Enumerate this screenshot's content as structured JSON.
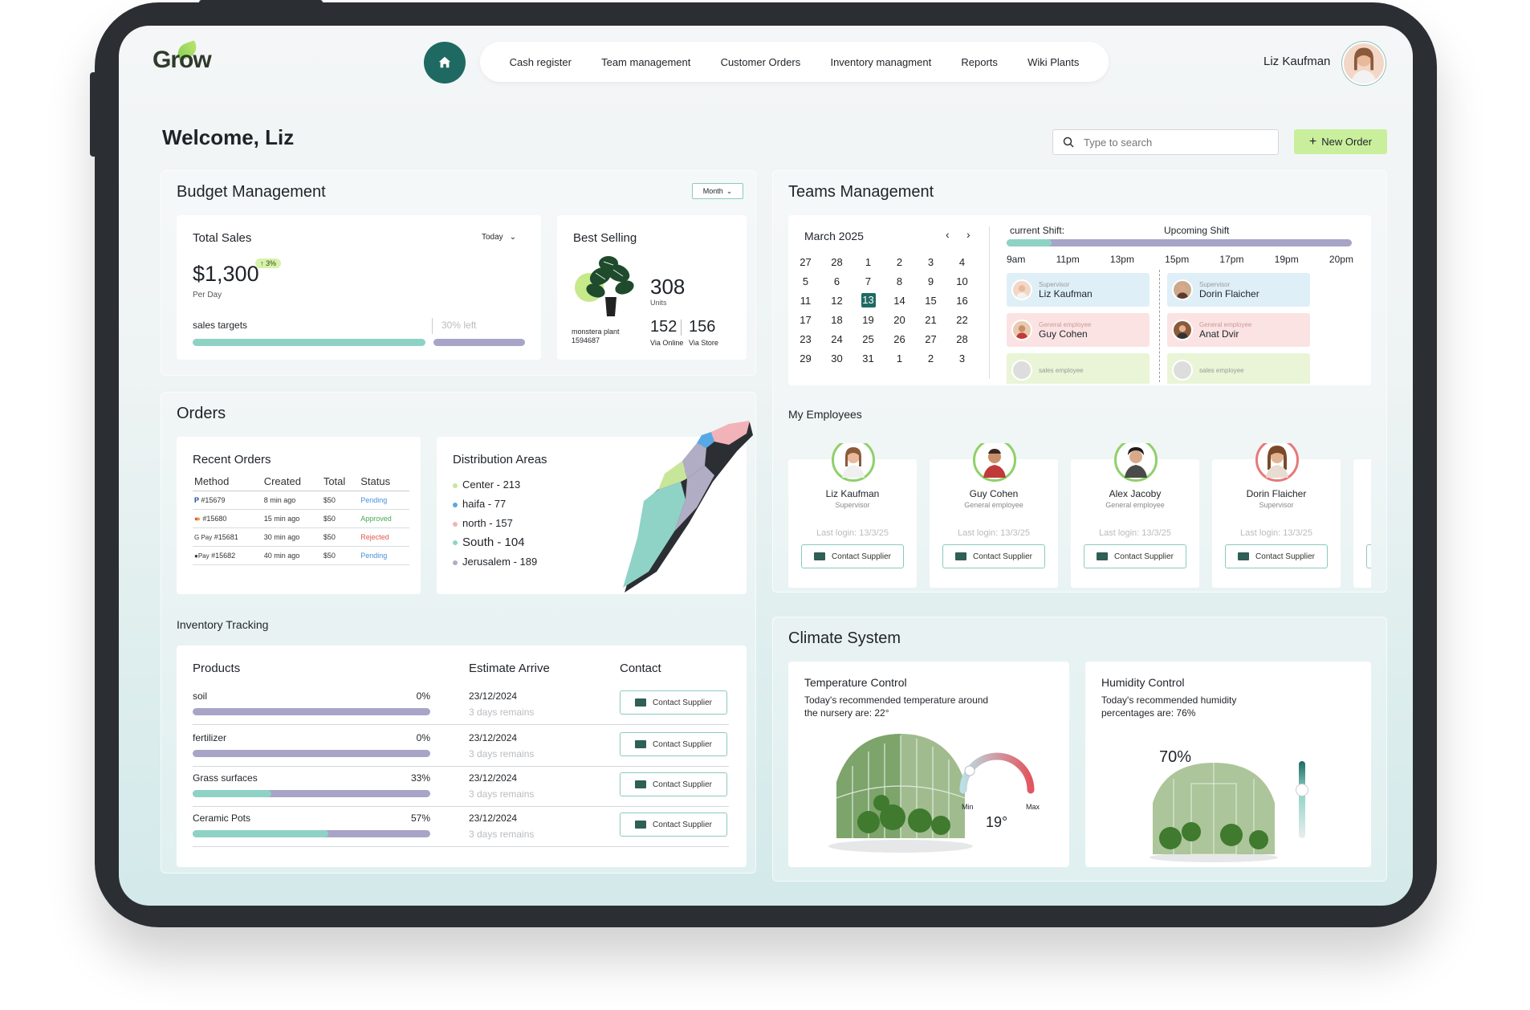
{
  "app": {
    "logo": "Grow",
    "user_name": "Liz Kaufman"
  },
  "nav": {
    "items": [
      "Cash register",
      "Team management",
      "Customer Orders",
      "Inventory managment",
      "Reports",
      "Wiki Plants"
    ]
  },
  "welcome": "Welcome, Liz",
  "search": {
    "placeholder": "Type to search"
  },
  "new_order": "New Order",
  "budget": {
    "title": "Budget Management",
    "period": "Month",
    "total_sales": {
      "label": "Total Sales",
      "range": "Today",
      "amount": "$1,300",
      "change": "3%",
      "per": "Per Day",
      "targets_label": "sales targets",
      "left_label": "30% left",
      "progress": 0.7
    },
    "best_selling": {
      "label": "Best Selling",
      "units": "308",
      "units_label": "Units",
      "product": "monstera plant",
      "sku": "1594687",
      "online": "152",
      "online_label": "Via Online",
      "store": "156",
      "store_label": "Via Store"
    }
  },
  "orders": {
    "title": "Orders",
    "recent": {
      "title": "Recent Orders",
      "headers": [
        "Method",
        "Created",
        "Total",
        "Status"
      ],
      "rows": [
        {
          "method": "#15679",
          "pay": "P",
          "created": "8 min ago",
          "total": "$50",
          "status": "Pending",
          "color": "#4a8fd9"
        },
        {
          "method": "#15680",
          "pay": "mc",
          "created": "15 min ago",
          "total": "$50",
          "status": "Approved",
          "color": "#4aa855"
        },
        {
          "method": "#15681",
          "pay": "G Pay",
          "created": "30 min ago",
          "total": "$50",
          "status": "Rejected",
          "color": "#e05a4f"
        },
        {
          "method": "#15682",
          "pay": "Pay",
          "created": "40 min ago",
          "total": "$50",
          "status": "Pending",
          "color": "#4a8fd9"
        }
      ]
    },
    "distribution": {
      "title": "Distribution Areas",
      "areas": [
        {
          "label": "Center - 213",
          "color": "#c7e69a"
        },
        {
          "label": "haifa - 77",
          "color": "#58a8e6"
        },
        {
          "label": "north - 157",
          "color": "#f2b3b8"
        },
        {
          "label": "South - 104",
          "color": "#8fd3c7"
        },
        {
          "label": "Jerusalem - 189",
          "color": "#b0adc4"
        }
      ]
    }
  },
  "inventory": {
    "title": "Inventory Tracking",
    "headers": {
      "products": "Products",
      "arrive": "Estimate Arrive",
      "contact": "Contact"
    },
    "contact_label": "Contact Supplier",
    "items": [
      {
        "name": "soil",
        "pct": "0%",
        "value": 0,
        "date": "23/12/2024",
        "remain": "3 days remains"
      },
      {
        "name": "fertilizer",
        "pct": "0%",
        "value": 0,
        "date": "23/12/2024",
        "remain": "3 days remains"
      },
      {
        "name": "Grass surfaces",
        "pct": "33%",
        "value": 0.33,
        "date": "23/12/2024",
        "remain": "3 days remains"
      },
      {
        "name": "Ceramic Pots",
        "pct": "57%",
        "value": 0.57,
        "date": "23/12/2024",
        "remain": "3 days remains"
      }
    ]
  },
  "teams": {
    "title": "Teams Management",
    "calendar": {
      "month": "March 2025",
      "weeks": [
        [
          "27",
          "28",
          "1",
          "2",
          "3",
          "4"
        ],
        [
          "5",
          "6",
          "7",
          "8",
          "9",
          "10"
        ],
        [
          "11",
          "12",
          "13",
          "14",
          "15",
          "16"
        ],
        [
          "17",
          "18",
          "19",
          "20",
          "21",
          "22"
        ],
        [
          "23",
          "24",
          "25",
          "26",
          "27",
          "28"
        ],
        [
          "29",
          "30",
          "31",
          "1",
          "2",
          "3"
        ]
      ],
      "selected": "13"
    },
    "current_shift": "current Shift:",
    "upcoming_shift": "Upcoming Shift",
    "times": [
      "9am",
      "11pm",
      "13pm",
      "15pm",
      "17pm",
      "19pm",
      "20pm"
    ],
    "shifts": [
      {
        "role": "Supervisor",
        "name": "Liz Kaufman"
      },
      {
        "role": "General employee",
        "name": "Guy Cohen"
      },
      {
        "role": "sales employee",
        "name": ""
      },
      {
        "role": "Supervisor",
        "name": "Dorin Flaicher"
      },
      {
        "role": "General employee",
        "name": "Anat Dvir"
      },
      {
        "role": "sales employee",
        "name": ""
      }
    ]
  },
  "employees": {
    "title": "My Employees",
    "contact_label": "Contact Supplier",
    "list": [
      {
        "name": "Liz Kaufman",
        "role": "Supervisor",
        "login": "Last login: 13/3/25",
        "ring": "#8fd06a"
      },
      {
        "name": "Guy Cohen",
        "role": "General employee",
        "login": "Last login: 13/3/25",
        "ring": "#8fd06a"
      },
      {
        "name": "Alex Jacoby",
        "role": "General employee",
        "login": "Last login: 13/3/25",
        "ring": "#8fd06a"
      },
      {
        "name": "Dorin Flaicher",
        "role": "Supervisor",
        "login": "Last login: 13/3/25",
        "ring": "#e5797a"
      }
    ]
  },
  "climate": {
    "title": "Climate System",
    "temperature": {
      "title": "Temperature Control",
      "desc": "Today's recommended temperature around the nursery are: 22°",
      "value": "19°",
      "min": "Min",
      "max": "Max"
    },
    "humidity": {
      "title": "Humidity Control",
      "desc": "Today's recommended humidity percentages are: 76%",
      "value": "70%"
    }
  }
}
